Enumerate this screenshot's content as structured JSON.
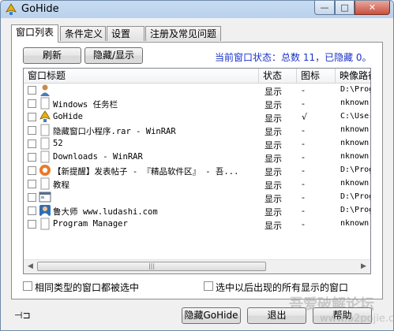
{
  "window": {
    "title": "GoHide",
    "min": "—",
    "max": "□",
    "close": "✕"
  },
  "tabs": [
    "窗口列表",
    "条件定义",
    "设置",
    "注册及常见问题"
  ],
  "toolbar": {
    "refresh": "刷新",
    "toggle": "隐藏/显示",
    "status": "当前窗口状态：总数 11，已隐藏 0。"
  },
  "columns": [
    "窗口标题",
    "状态",
    "图标",
    "映像路径"
  ],
  "rows": [
    {
      "title": "",
      "state": "显示",
      "icon": "-",
      "path": "D:\\Prog"
    },
    {
      "title": "Windows 任务栏",
      "state": "显示",
      "icon": "-",
      "path": "nknown"
    },
    {
      "title": "GoHide",
      "state": "显示",
      "icon": "√",
      "path": "C:\\User"
    },
    {
      "title": "隐藏窗口小程序.rar - WinRAR",
      "state": "显示",
      "icon": "-",
      "path": "nknown"
    },
    {
      "title": "52",
      "state": "显示",
      "icon": "-",
      "path": "nknown"
    },
    {
      "title": "Downloads - WinRAR",
      "state": "显示",
      "icon": "-",
      "path": "nknown"
    },
    {
      "title": "【新提醒】发表帖子 - 『精品软件区』 - 吾...",
      "state": "显示",
      "icon": "-",
      "path": "D:\\Prog"
    },
    {
      "title": "教程",
      "state": "显示",
      "icon": "-",
      "path": "nknown"
    },
    {
      "title": "",
      "state": "显示",
      "icon": "-",
      "path": "D:\\Prog"
    },
    {
      "title": "鲁大师 www.ludashi.com",
      "state": "显示",
      "icon": "-",
      "path": "D:\\Prog"
    },
    {
      "title": "Program Manager",
      "state": "显示",
      "icon": "-",
      "path": "nknown"
    }
  ],
  "options": {
    "same_type": "相同类型的窗口都被选中",
    "select_later": "选中以后出现的所有显示的窗口"
  },
  "footer": {
    "pin": "⊣⊐",
    "hide": "隐藏GoHide",
    "exit": "退出",
    "help": "帮助"
  },
  "watermark": {
    "line1": "吾爱破解论坛",
    "line2": "www.52pojie.cn"
  },
  "colors": {
    "status": "#1a32c8",
    "close": "#c8503f"
  }
}
